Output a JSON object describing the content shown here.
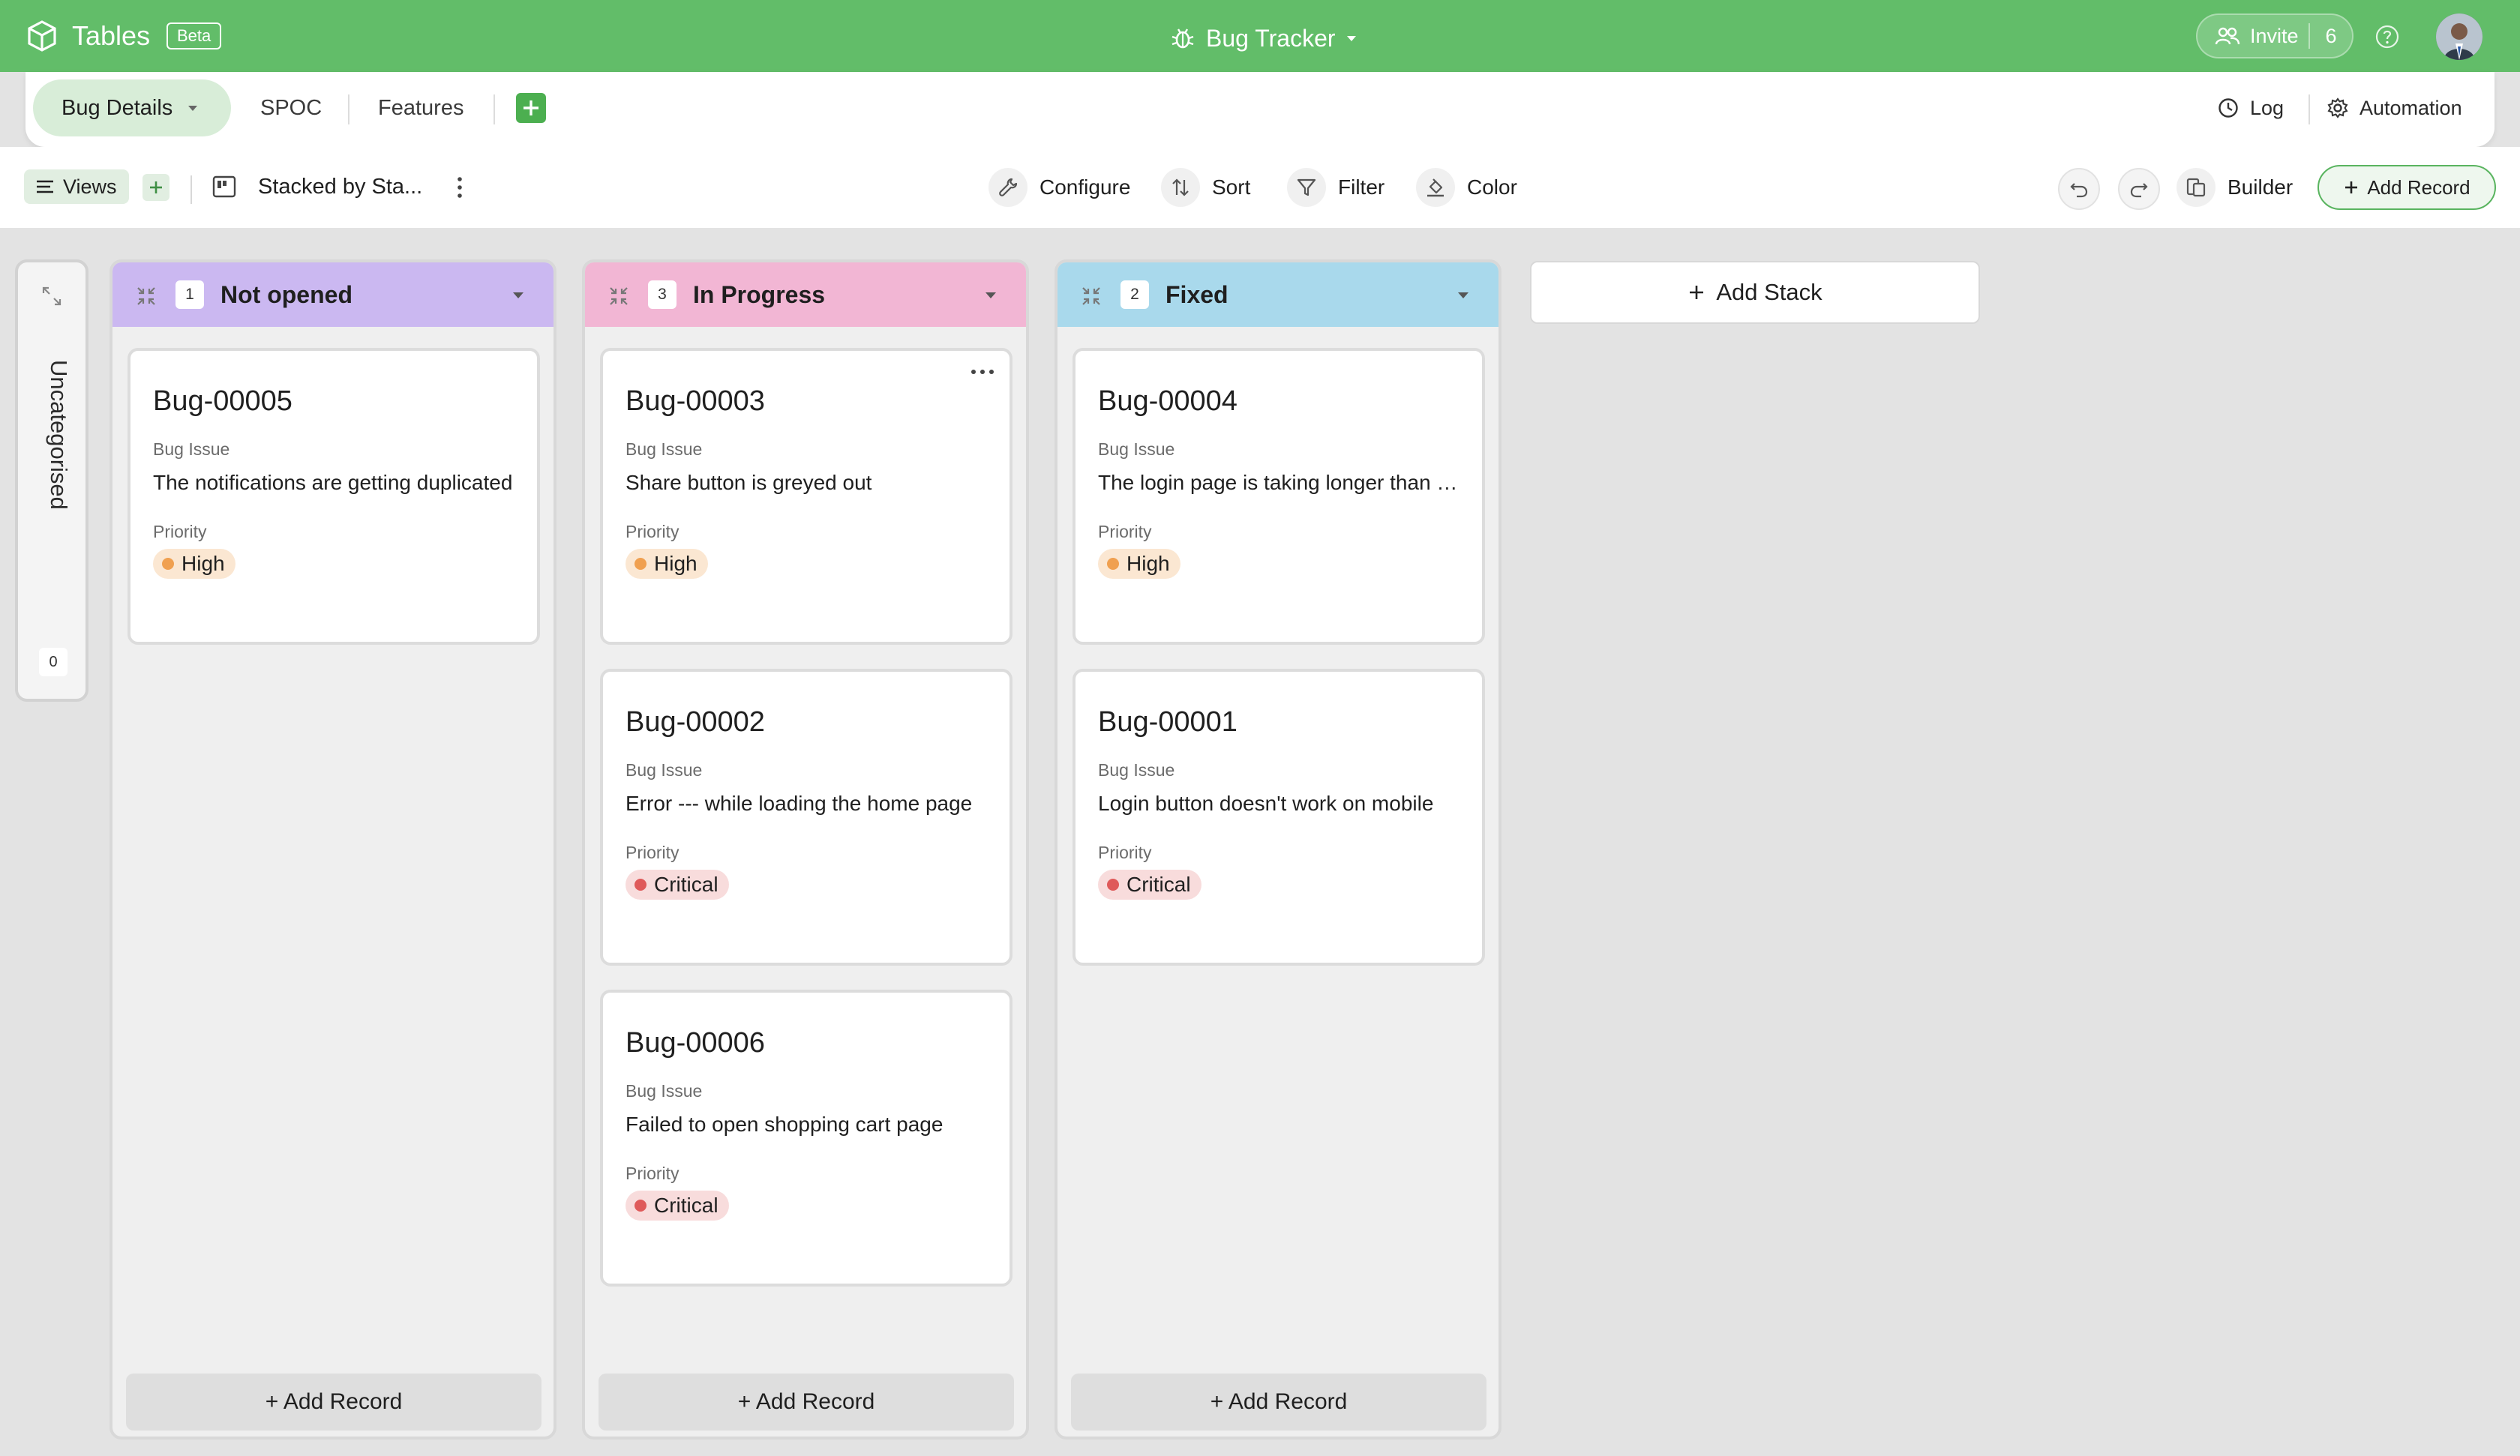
{
  "app": {
    "name": "Tables",
    "badge": "Beta"
  },
  "base": {
    "title": "Bug Tracker",
    "icon": "bug-icon"
  },
  "header": {
    "invite_label": "Invite",
    "invite_count": "6",
    "help_icon": "help-circle-icon"
  },
  "tabs": {
    "active": "Bug Details",
    "items": [
      "SPOC",
      "Features"
    ],
    "right": {
      "log_label": "Log",
      "automation_label": "Automation"
    }
  },
  "toolbar": {
    "views_label": "Views",
    "view_name": "Stacked by Sta...",
    "configure_label": "Configure",
    "sort_label": "Sort",
    "filter_label": "Filter",
    "color_label": "Color",
    "builder_label": "Builder",
    "add_record_label": "Add Record"
  },
  "uncategorised": {
    "label": "Uncategorised",
    "count": "0"
  },
  "stacks": [
    {
      "name": "Not opened",
      "count": "1",
      "color": "#cbb8f1",
      "cards": [
        {
          "id": "Bug-00005",
          "field1": "Bug Issue",
          "value1": "The notifications are getting duplicated",
          "field2": "Priority",
          "priority": "High"
        }
      ],
      "add_label": "+ Add Record"
    },
    {
      "name": "In Progress",
      "count": "3",
      "color": "#f2b6d4",
      "cards": [
        {
          "id": "Bug-00003",
          "field1": "Bug Issue",
          "value1": "Share button is greyed out",
          "field2": "Priority",
          "priority": "High"
        },
        {
          "id": "Bug-00002",
          "field1": "Bug Issue",
          "value1": "Error --- while loading the home page",
          "field2": "Priority",
          "priority": "Critical"
        },
        {
          "id": "Bug-00006",
          "field1": "Bug Issue",
          "value1": "Failed to open shopping cart page",
          "field2": "Priority",
          "priority": "Critical"
        }
      ],
      "add_label": "+ Add Record"
    },
    {
      "name": "Fixed",
      "count": "2",
      "color": "#a9d9ec",
      "cards": [
        {
          "id": "Bug-00004",
          "field1": "Bug Issue",
          "value1": "The login page is taking longer than expected",
          "field2": "Priority",
          "priority": "High"
        },
        {
          "id": "Bug-00001",
          "field1": "Bug Issue",
          "value1": "Login button doesn't work on mobile",
          "field2": "Priority",
          "priority": "Critical"
        }
      ],
      "add_label": "+ Add Record"
    }
  ],
  "add_stack_label": "Add Stack",
  "priority_colors": {
    "High": {
      "bg": "#fbe7d2",
      "dot": "#f0a050"
    },
    "Critical": {
      "bg": "#f8dcdc",
      "dot": "#df5a5a"
    }
  },
  "colors": {
    "brand_green": "#62bd69"
  }
}
